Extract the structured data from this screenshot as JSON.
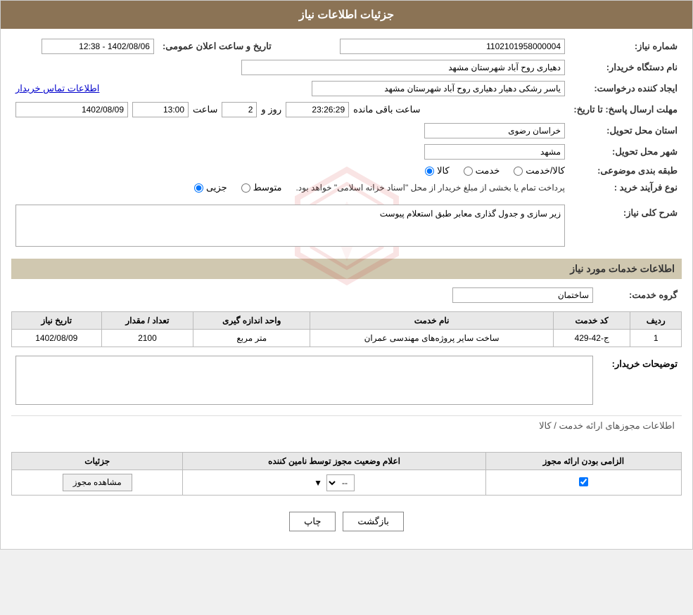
{
  "page": {
    "title": "جزئیات اطلاعات نیاز"
  },
  "header": {
    "announcement_number_label": "شماره نیاز:",
    "announcement_number_value": "1102101958000004",
    "announce_date_label": "تاریخ و ساعت اعلان عمومی:",
    "announce_date_value": "1402/08/06 - 12:38",
    "buyer_name_label": "نام دستگاه خریدار:",
    "buyer_name_value": "دهیاری روح آباد شهرستان مشهد",
    "requester_label": "ایجاد کننده درخواست:",
    "requester_value": "یاسر رشکی دهیار دهیاری روح آباد شهرستان مشهد",
    "contact_link": "اطلاعات تماس خریدار",
    "deadline_label": "مهلت ارسال پاسخ: تا تاریخ:",
    "deadline_date": "1402/08/09",
    "deadline_time_label": "ساعت",
    "deadline_time": "13:00",
    "remaining_days_label": "روز و",
    "remaining_days": "2",
    "remaining_time": "23:26:29",
    "remaining_suffix": "ساعت باقی مانده",
    "province_label": "استان محل تحویل:",
    "province_value": "خراسان رضوی",
    "city_label": "شهر محل تحویل:",
    "city_value": "مشهد",
    "category_label": "طبقه بندی موضوعی:",
    "category_kala": "کالا",
    "category_khadamat": "خدمت",
    "category_kala_khadamat": "کالا/خدمت",
    "purchase_type_label": "نوع فرآیند خرید :",
    "purchase_jozee": "جزیی",
    "purchase_motavasset": "متوسط",
    "purchase_desc": "پرداخت تمام یا بخشی از مبلغ خریدار از محل \"اسناد خزانه اسلامی\" خواهد بود."
  },
  "need_description": {
    "section_title": "شرح کلی نیاز:",
    "value": "زیر سازی و جدول گذاری معابر طبق استعلام پیوست"
  },
  "services": {
    "section_title": "اطلاعات خدمات مورد نیاز",
    "service_group_label": "گروه خدمت:",
    "service_group_value": "ساختمان",
    "table": {
      "columns": [
        "ردیف",
        "کد خدمت",
        "نام خدمت",
        "واحد اندازه گیری",
        "تعداد / مقدار",
        "تاریخ نیاز"
      ],
      "rows": [
        {
          "row": "1",
          "code": "ج-42-429",
          "name": "ساخت سایر پروژه‌های مهندسی عمران",
          "unit": "متر مربع",
          "qty": "2100",
          "date": "1402/08/09"
        }
      ]
    }
  },
  "buyer_notes": {
    "label": "توضیحات خریدار:",
    "value": ""
  },
  "permits": {
    "section_title": "اطلاعات مجوزهای ارائه خدمت / کالا",
    "table": {
      "columns": [
        "الزامی بودن ارائه مجوز",
        "اعلام وضعیت مجوز توسط نامین کننده",
        "جزئیات"
      ],
      "rows": [
        {
          "required": true,
          "status": "--",
          "details_btn": "مشاهده مجوز"
        }
      ]
    }
  },
  "buttons": {
    "print": "چاپ",
    "back": "بازگشت"
  }
}
